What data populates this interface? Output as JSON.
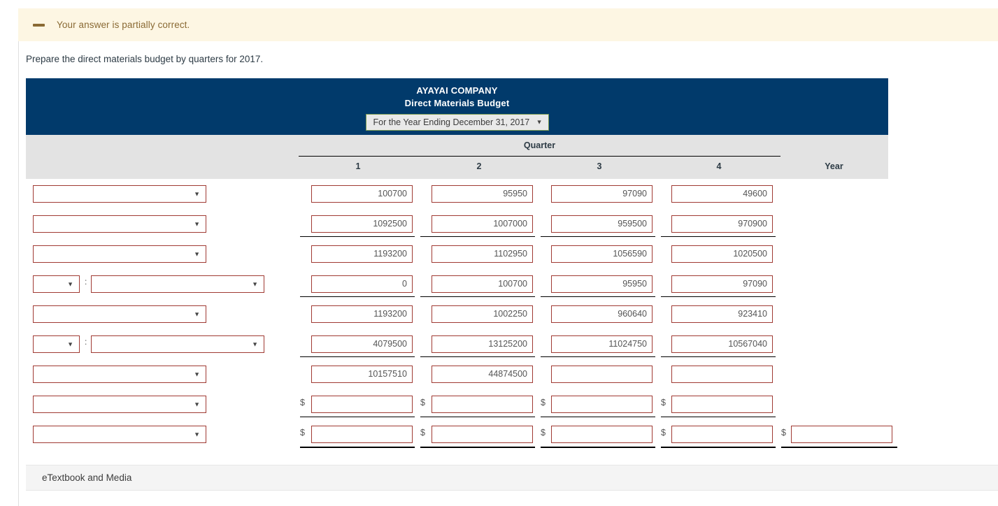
{
  "alert": {
    "icon": "minus-icon",
    "message": "Your answer is partially correct.",
    "bg_color": "#fdf6e3",
    "text_color": "#8a6a34"
  },
  "prompt": "Prepare the direct materials budget by quarters for 2017.",
  "budget": {
    "header": {
      "company": "AYAYAI COMPANY",
      "report_title": "Direct Materials Budget",
      "period_selected": "For the Year Ending December 31, 2017",
      "bg_color": "#013a6b",
      "select_border_color": "#7a9a52"
    },
    "columns": {
      "group_label": "Quarter",
      "q1": "1",
      "q2": "2",
      "q3": "3",
      "q4": "4",
      "year": "Year",
      "band_color": "#e3e3e3"
    },
    "input_border_color": "#a03a33",
    "dollar_sign": "$",
    "colon": ":",
    "rows": [
      {
        "label_type": "single",
        "label": "",
        "q1": "100700",
        "q2": "95950",
        "q3": "97090",
        "q4": "49600",
        "year": "",
        "dollar": false,
        "rule": "none"
      },
      {
        "label_type": "single",
        "label": "",
        "q1": "1092500",
        "q2": "1007000",
        "q3": "959500",
        "q4": "970900",
        "year": "",
        "dollar": false,
        "rule": "single"
      },
      {
        "label_type": "single",
        "label": "",
        "q1": "1193200",
        "q2": "1102950",
        "q3": "1056590",
        "q4": "1020500",
        "year": "",
        "dollar": false,
        "rule": "none"
      },
      {
        "label_type": "split",
        "label": "",
        "label2": "",
        "q1": "0",
        "q2": "100700",
        "q3": "95950",
        "q4": "97090",
        "year": "",
        "dollar": false,
        "rule": "single"
      },
      {
        "label_type": "single",
        "label": "",
        "q1": "1193200",
        "q2": "1002250",
        "q3": "960640",
        "q4": "923410",
        "year": "",
        "dollar": false,
        "rule": "none"
      },
      {
        "label_type": "split",
        "label": "",
        "label2": "",
        "q1": "4079500",
        "q2": "13125200",
        "q3": "11024750",
        "q4": "10567040",
        "year": "",
        "dollar": false,
        "rule": "single"
      },
      {
        "label_type": "single",
        "label": "",
        "q1": "10157510",
        "q2": "44874500",
        "q3": "",
        "q4": "",
        "year": "",
        "dollar": false,
        "rule": "none"
      },
      {
        "label_type": "single",
        "label": "",
        "q1": "",
        "q2": "",
        "q3": "",
        "q4": "",
        "year": "",
        "dollar": true,
        "rule": "single"
      },
      {
        "label_type": "single",
        "label": "",
        "q1": "",
        "q2": "",
        "q3": "",
        "q4": "",
        "year": "",
        "dollar": true,
        "year_input": true,
        "rule": "thick"
      }
    ]
  },
  "footer": {
    "etextbook_label": "eTextbook and Media"
  }
}
